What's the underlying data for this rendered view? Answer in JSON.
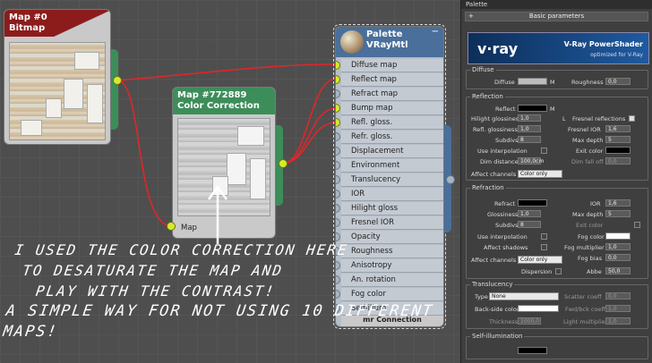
{
  "canvas": {
    "bitmap_node": {
      "title_line1": "Map #0",
      "title_line2": "Bitmap"
    },
    "cc_node": {
      "title_line1": "Map #772889",
      "title_line2": "Color Correction",
      "input_label": "Map"
    },
    "material_node": {
      "title_line1": "Palette",
      "title_line2": "VRayMtl",
      "footer": "mr Connection",
      "slots": [
        "Diffuse map",
        "Reflect map",
        "Refract map",
        "Bump map",
        "Refl. gloss.",
        "Refr. gloss.",
        "Displacement",
        "Environment",
        "Translucency",
        "IOR",
        "Hilight gloss",
        "Fresnel IOR",
        "Opacity",
        "Roughness",
        "Anisotropy",
        "An. rotation",
        "Fog color",
        "Self-illum"
      ],
      "connected_slots": [
        0,
        1,
        3,
        4
      ]
    },
    "annotation": [
      "I USED THE COLOR CORRECTION HERE",
      "TO DESATURATE THE MAP AND",
      "PLAY WITH THE CONTRAST!",
      "A SIMPLE WAY FOR NOT USING 10 DIFFERENT MAPS!"
    ],
    "colors": {
      "wire": "#e0262a",
      "socket": "#d7e82e",
      "node_header_bitmap": "#8c1c1c",
      "node_header_cc": "#3d8d5a",
      "node_header_mtl": "#4a6f9a"
    }
  },
  "panel": {
    "title": "Palette",
    "rollout": "Basic parameters",
    "banner": {
      "logo": "v·ray",
      "title": "V-Ray PowerShader",
      "subtitle": "optimized for V-Ray"
    },
    "diffuse": {
      "group": "Diffuse",
      "diffuse_label": "Diffuse",
      "m": "M",
      "roughness_label": "Roughness",
      "roughness_value": "0,0"
    },
    "reflection": {
      "group": "Reflection",
      "reflect": "Reflect",
      "m": "M",
      "hilight": "Hilight glossiness",
      "hilight_val": "1,0",
      "l": "L",
      "fresnel": "Fresnel reflections",
      "refl_gloss": "Refl. glossiness",
      "refl_gloss_val": "1,0",
      "fresnel_ior": "Fresnel IOR",
      "fresnel_ior_val": "1,6",
      "subdivs": "Subdivs",
      "subdivs_val": "8",
      "max_depth": "Max depth",
      "max_depth_val": "5",
      "use_interp": "Use interpolation",
      "exit_color": "Exit color",
      "dim_distance": "Dim distance",
      "dim_distance_val": "100,0cm",
      "dim_falloff": "Dim fall off",
      "dim_falloff_val": "0,0",
      "affect_channels": "Affect channels",
      "affect_val": "Color only"
    },
    "refraction": {
      "group": "Refraction",
      "refract": "Refract",
      "ior": "IOR",
      "ior_val": "1,6",
      "glossiness": "Glossiness",
      "gloss_val": "1,0",
      "max_depth": "Max depth",
      "max_depth_val": "5",
      "subdivs": "Subdivs",
      "subdivs_val": "8",
      "exit_color": "Exit color",
      "use_interp": "Use interpolation",
      "fog_color": "Fog color",
      "affect_shadows": "Affect shadows",
      "fog_mult": "Fog multiplier",
      "fog_mult_val": "1,0",
      "fog_bias": "Fog bias",
      "fog_bias_val": "0,0",
      "affect_channels": "Affect channels",
      "affect_val": "Color only",
      "dispersion": "Dispersion",
      "abbe": "Abbe",
      "abbe_val": "50,0"
    },
    "translucency": {
      "group": "Translucency",
      "type": "Type",
      "type_val": "None",
      "scatter": "Scatter coeff",
      "scatter_val": "0,0",
      "back_side": "Back-side color",
      "fwd_bck": "Fwd/bck coeff",
      "fwd_bck_val": "1,0",
      "thickness": "Thickness",
      "thickness_val": "1000,0",
      "light_mult": "Light multiplier",
      "light_mult_val": "1,0"
    },
    "self_illum": {
      "group": "Self-illumination"
    }
  }
}
